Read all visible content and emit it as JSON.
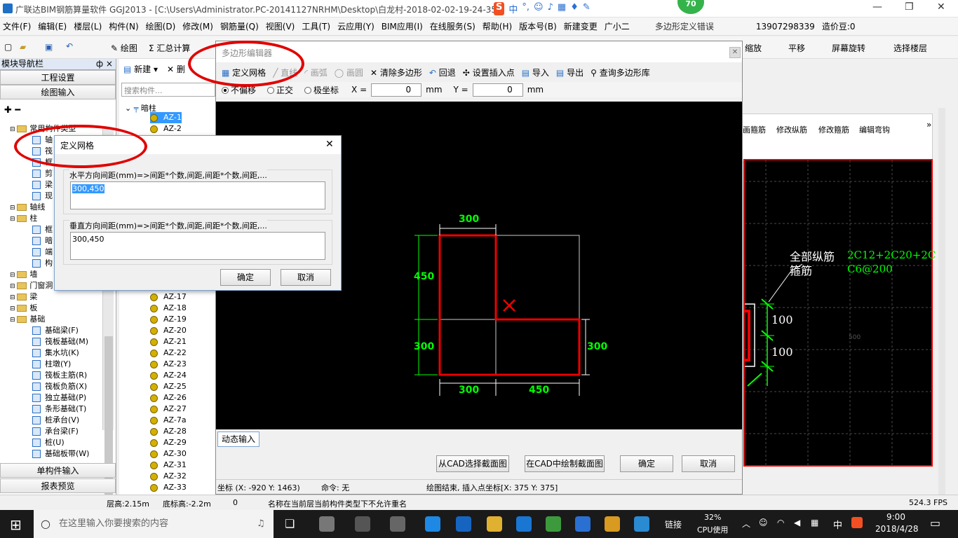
{
  "window": {
    "title": "广联达BIM钢筋算量软件 GGJ2013 - [C:\\Users\\Administrator.PC-20141127NRHM\\Desktop\\白龙村-2018-02-02-19-24-35"
  },
  "ime": {
    "brand": "S",
    "lang": "中",
    "punct": "°,"
  },
  "badge": "70",
  "menu": [
    "文件(F)",
    "编辑(E)",
    "楼层(L)",
    "构件(N)",
    "绘图(D)",
    "修改(M)",
    "钢筋量(Q)",
    "视图(V)",
    "工具(T)",
    "云应用(Y)",
    "BIM应用(I)",
    "在线服务(S)",
    "帮助(H)",
    "版本号(B)",
    "新建变更",
    "广小二"
  ],
  "menu_right": {
    "error": "多边形定义错误",
    "phone": "13907298339",
    "price": "造价豆:0"
  },
  "toolbar": {
    "draw": "绘图",
    "sum": "汇总计算",
    "zoom": "缩放",
    "pan": "平移",
    "rotate": "屏幕旋转",
    "select_floor": "选择楼层"
  },
  "left": {
    "title": "模块导航栏",
    "pin": "ф ×",
    "btn_project": "工程设置",
    "btn_draw": "绘图输入",
    "btn_single": "单构件输入",
    "btn_report": "报表预览",
    "tree": [
      {
        "label": "常用构件类型",
        "type": "folder"
      },
      {
        "label": "轴",
        "type": "item"
      },
      {
        "label": "筏",
        "type": "item"
      },
      {
        "label": "框",
        "type": "item"
      },
      {
        "label": "剪",
        "type": "item"
      },
      {
        "label": "梁",
        "type": "item"
      },
      {
        "label": "现",
        "type": "item"
      },
      {
        "label": "轴线",
        "type": "folder"
      },
      {
        "label": "柱",
        "type": "folder"
      },
      {
        "label": "框",
        "type": "item"
      },
      {
        "label": "暗",
        "type": "item"
      },
      {
        "label": "端",
        "type": "item"
      },
      {
        "label": "构",
        "type": "item"
      },
      {
        "label": "墙",
        "type": "folder"
      },
      {
        "label": "门窗洞",
        "type": "folder"
      },
      {
        "label": "梁",
        "type": "folder"
      },
      {
        "label": "板",
        "type": "folder"
      },
      {
        "label": "基础",
        "type": "folder"
      },
      {
        "label": "基础梁(F)",
        "type": "item"
      },
      {
        "label": "筏板基础(M)",
        "type": "item"
      },
      {
        "label": "集水坑(K)",
        "type": "item"
      },
      {
        "label": "柱墩(Y)",
        "type": "item"
      },
      {
        "label": "筏板主筋(R)",
        "type": "item"
      },
      {
        "label": "筏板负筋(X)",
        "type": "item"
      },
      {
        "label": "独立基础(P)",
        "type": "item"
      },
      {
        "label": "条形基础(T)",
        "type": "item"
      },
      {
        "label": "桩承台(V)",
        "type": "item"
      },
      {
        "label": "承台梁(F)",
        "type": "item"
      },
      {
        "label": "桩(U)",
        "type": "item"
      },
      {
        "label": "基础板带(W)",
        "type": "item"
      }
    ]
  },
  "mid": {
    "new": "新建",
    "del": "删",
    "search_placeholder": "搜索构件...",
    "root": "暗柱",
    "items": [
      "AZ-1",
      "AZ-2",
      "AZ-17",
      "AZ-18",
      "AZ-19",
      "AZ-20",
      "AZ-21",
      "AZ-22",
      "AZ-23",
      "AZ-24",
      "AZ-25",
      "AZ-26",
      "AZ-27",
      "AZ-7a",
      "AZ-28",
      "AZ-29",
      "AZ-30",
      "AZ-31",
      "AZ-32",
      "AZ-33"
    ]
  },
  "poly": {
    "title": "多边形编辑器",
    "tools": {
      "grid": "定义网格",
      "line": "直线",
      "arc": "画弧",
      "circle": "画圆",
      "clear": "清除多边形",
      "undo": "回退",
      "insert": "设置插入点",
      "import": "导入",
      "export": "导出",
      "query": "查询多边形库"
    },
    "coords": {
      "noshift": "不偏移",
      "ortho": "正交",
      "polar": "极坐标",
      "x_label": "X =",
      "x_val": "0",
      "y_label": "Y =",
      "y_val": "0",
      "unit": "mm"
    },
    "dim": {
      "top": "300",
      "left_top": "450",
      "left_bottom": "300",
      "right": "300",
      "bottom1": "300",
      "bottom2": "450"
    },
    "dynamic": "动态输入",
    "btn_cad_select": "从CAD选择截面图",
    "btn_cad_draw": "在CAD中绘制截面图",
    "btn_ok": "确定",
    "btn_cancel": "取消",
    "status_coord": "坐标 (X: -920 Y: 1463)",
    "status_cmd": "命令: 无",
    "status_msg": "绘图结束, 插入点坐标[X: 375 Y: 375]"
  },
  "grid_dialog": {
    "title": "定义网格",
    "h_label": "水平方向间距(mm)=>间距*个数,间距,间距*个数,间距,...",
    "h_value": "300,450",
    "v_label": "垂直方向间距(mm)=>间距*个数,间距,间距*个数,间距,...",
    "v_value": "300,450",
    "ok": "确定",
    "cancel": "取消"
  },
  "right": {
    "tabs": [
      "画箍筋",
      "修改纵筋",
      "修改箍筋",
      "编辑弯钩"
    ],
    "rebar_all": "全部纵筋",
    "rebar_all_val": "2C12+2C20+2C",
    "stirrup": "箍筋",
    "stirrup_val": "C6@200",
    "dim1": "100",
    "dim2": "100",
    "grid_text": "500"
  },
  "status": {
    "floor_h": "层高:2.15m",
    "bottom_h": "底标高:-2.2m",
    "zero": "0",
    "msg": "名称在当前层当前构件类型下不允许重名",
    "fps": "524.3 FPS"
  },
  "taskbar": {
    "search": "在这里输入你要搜索的内容",
    "link": "链接",
    "cpu_pct": "32%",
    "cpu": "CPU使用",
    "lang": "中",
    "time": "9:00",
    "date": "2018/4/28"
  },
  "colors": {
    "accent_red": "#e00000",
    "cad_green": "#00ff00",
    "cad_bg": "#000000"
  }
}
